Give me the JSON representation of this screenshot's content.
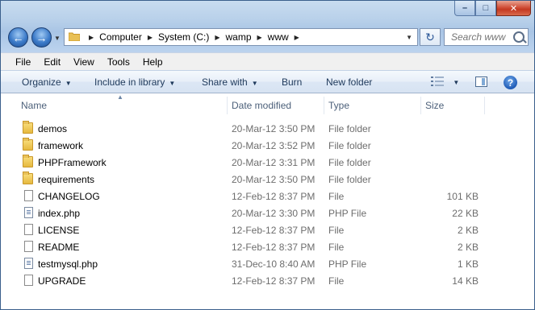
{
  "address": {
    "crumbs": [
      "Computer",
      "System (C:)",
      "wamp",
      "www"
    ]
  },
  "search": {
    "placeholder": "Search www"
  },
  "menu": [
    "File",
    "Edit",
    "View",
    "Tools",
    "Help"
  ],
  "commands": {
    "organize": "Organize",
    "include_in_library": "Include in library",
    "share_with": "Share with",
    "burn": "Burn",
    "new_folder": "New folder"
  },
  "columns": {
    "name": "Name",
    "date_modified": "Date modified",
    "type": "Type",
    "size": "Size"
  },
  "files": [
    {
      "name": "demos",
      "date": "20-Mar-12 3:50 PM",
      "type": "File folder",
      "size": "",
      "icon": "folder-icon"
    },
    {
      "name": "framework",
      "date": "20-Mar-12 3:52 PM",
      "type": "File folder",
      "size": "",
      "icon": "folder-icon"
    },
    {
      "name": "PHPFramework",
      "date": "20-Mar-12 3:31 PM",
      "type": "File folder",
      "size": "",
      "icon": "folder-icon"
    },
    {
      "name": "requirements",
      "date": "20-Mar-12 3:50 PM",
      "type": "File folder",
      "size": "",
      "icon": "folder-icon"
    },
    {
      "name": "CHANGELOG",
      "date": "12-Feb-12 8:37 PM",
      "type": "File",
      "size": "101 KB",
      "icon": "file-icon"
    },
    {
      "name": "index.php",
      "date": "20-Mar-12 3:30 PM",
      "type": "PHP File",
      "size": "22 KB",
      "icon": "php-file-icon"
    },
    {
      "name": "LICENSE",
      "date": "12-Feb-12 8:37 PM",
      "type": "File",
      "size": "2 KB",
      "icon": "file-icon"
    },
    {
      "name": "README",
      "date": "12-Feb-12 8:37 PM",
      "type": "File",
      "size": "2 KB",
      "icon": "file-icon"
    },
    {
      "name": "testmysql.php",
      "date": "31-Dec-10 8:40 AM",
      "type": "PHP File",
      "size": "1 KB",
      "icon": "php-file-icon"
    },
    {
      "name": "UPGRADE",
      "date": "12-Feb-12 8:37 PM",
      "type": "File",
      "size": "14 KB",
      "icon": "file-icon"
    }
  ],
  "colors": {
    "frame": "#b9d1ea",
    "close_button": "#c43a22",
    "command_text": "#1e395b",
    "muted_text": "#6d6d6d"
  }
}
